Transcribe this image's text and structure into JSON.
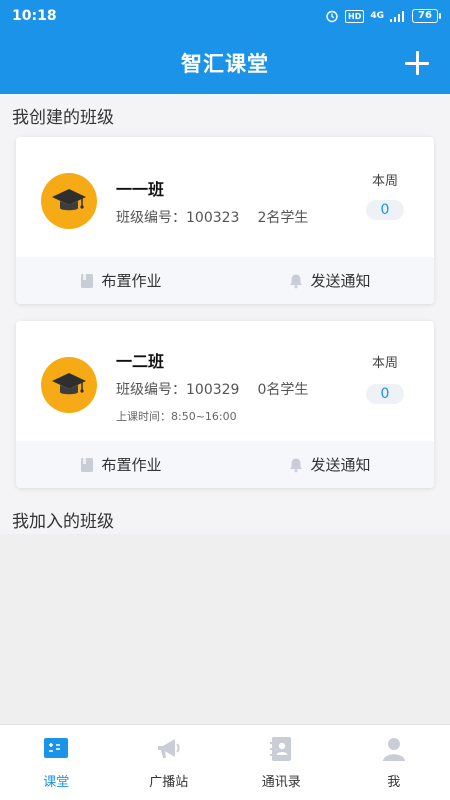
{
  "status_bar": {
    "time": "10:18",
    "hd": "HD",
    "network": "4G",
    "battery": "76"
  },
  "app_bar": {
    "title": "智汇课堂"
  },
  "sections": {
    "created": "我创建的班级",
    "joined": "我加入的班级"
  },
  "classes": [
    {
      "name": "一一班",
      "code_label": "班级编号：100323",
      "students": "2名学生",
      "class_time": "",
      "week_label": "本周",
      "week_count": "0",
      "assign_label": "布置作业",
      "notify_label": "发送通知"
    },
    {
      "name": "一二班",
      "code_label": "班级编号：100329",
      "students": "0名学生",
      "class_time": "上课时间：8:50~16:00",
      "week_label": "本周",
      "week_count": "0",
      "assign_label": "布置作业",
      "notify_label": "发送通知"
    }
  ],
  "tabs": [
    {
      "label": "课堂",
      "active": true
    },
    {
      "label": "广播站",
      "active": false
    },
    {
      "label": "通讯录",
      "active": false
    },
    {
      "label": "我",
      "active": false
    }
  ],
  "colors": {
    "primary": "#1a93e9",
    "avatar": "#f6ab16",
    "inactive_icon": "#c8cdd6"
  }
}
